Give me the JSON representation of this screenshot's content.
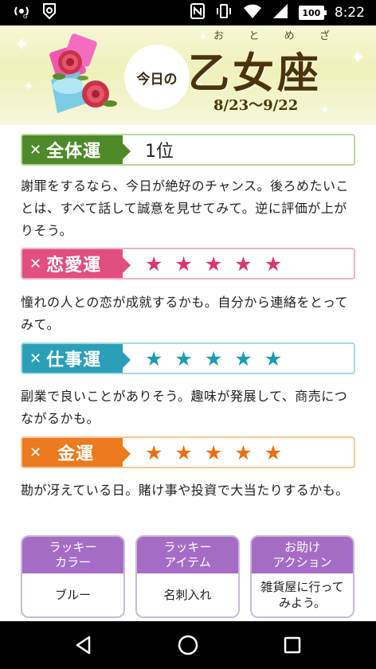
{
  "status_bar": {
    "time": "8:22",
    "battery": "100",
    "icons": [
      "hotspot-icon",
      "guard-app-icon",
      "nfc-icon",
      "vibrate-icon",
      "wifi-icon",
      "signal-icon",
      "battery-icon"
    ]
  },
  "header": {
    "today_label": "今日の",
    "sign_name": "乙女座",
    "sign_ruby": [
      "お",
      "と",
      "め",
      "ざ"
    ],
    "dates": "8/23〜9/22"
  },
  "fortunes": [
    {
      "label": "全体運",
      "rank": "1位",
      "color": "#4f8a2a",
      "description": "謝罪をするなら、今日が絶好のチャンス。後ろめたいことは、すべて話して誠意を見せてみて。逆に評価が上がりそう。"
    },
    {
      "label": "恋愛運",
      "stars": 5,
      "color": "#e04f7e",
      "star_color": "#d9376d",
      "description": "憧れの人との恋が成就するかも。自分から連絡をとってみて。"
    },
    {
      "label": "仕事運",
      "stars": 5,
      "color": "#2aa0b8",
      "star_color": "#1c9bb2",
      "description": "副業で良いことがありそう。趣味が発展して、商売につながるかも。"
    },
    {
      "label": "金運",
      "stars": 5,
      "color": "#ec7a1e",
      "star_color": "#ea6f12",
      "description": "勘が冴えている日。賭け事や投資で大当たりするかも。"
    }
  ],
  "lucky": [
    {
      "title_lines": [
        "ラッキー",
        "カラー"
      ],
      "value_lines": [
        "ブルー"
      ]
    },
    {
      "title_lines": [
        "ラッキー",
        "アイテム"
      ],
      "value_lines": [
        "名刺入れ"
      ]
    },
    {
      "title_lines": [
        "お助け",
        "アクション"
      ],
      "value_lines": [
        "雑貨屋に行って",
        "みよう。"
      ]
    }
  ],
  "colors": {
    "header_bg": "#eef1b9",
    "lucky_head": "#a56cc6",
    "row_border_green": "#b9d49a",
    "row_border_pink": "#f1b3c8",
    "row_border_cyan": "#a6d9e4",
    "row_border_orange": "#f7c597"
  },
  "nav": {
    "icons": [
      "back-icon",
      "home-icon",
      "recents-icon"
    ]
  }
}
